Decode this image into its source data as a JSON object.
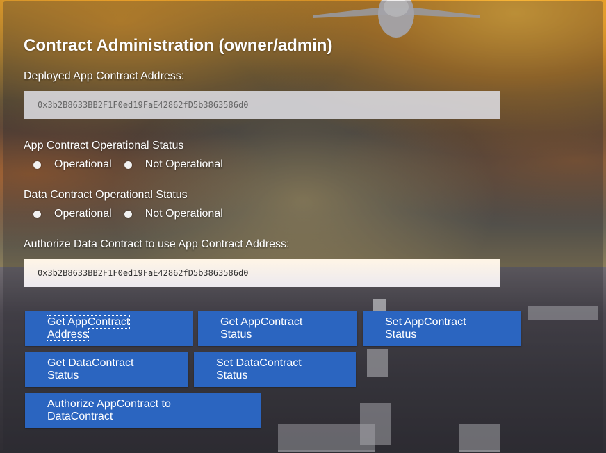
{
  "page": {
    "title": "Contract Administration (owner/admin)"
  },
  "deployed_address": {
    "label": "Deployed App Contract Address:",
    "value": "0x3b2B8633BB2F1F0ed19FaE42862fD5b3863586d0"
  },
  "app_status": {
    "label": "App Contract Operational Status",
    "options": [
      "Operational",
      "Not Operational"
    ]
  },
  "data_status": {
    "label": "Data Contract Operational Status",
    "options": [
      "Operational",
      "Not Operational"
    ]
  },
  "authorize": {
    "label": "Authorize Data Contract to use App Contract Address:",
    "value": "0x3b2B8633BB2F1F0ed19FaE42862fD5b3863586d0"
  },
  "buttons": {
    "get_app_address": "Get AppContract Address",
    "get_app_status": "Get AppContract Status",
    "set_app_status": "Set AppContract Status",
    "get_data_status": "Get DataContract Status",
    "set_data_status": "Set DataContract Status",
    "authorize_app": "Authorize AppContract to DataContract"
  },
  "colors": {
    "button": "#2b65c0",
    "text": "#ffffff"
  }
}
